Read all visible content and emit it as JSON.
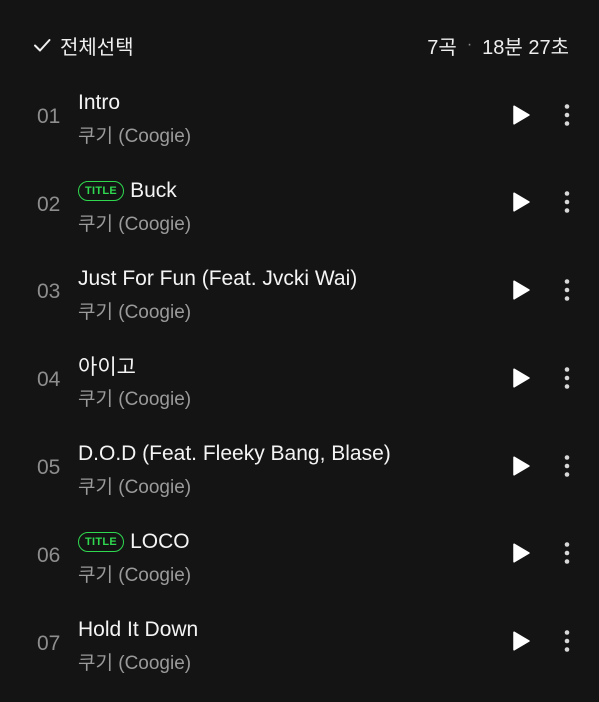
{
  "header": {
    "select_all_label": "전체선택",
    "track_count": "7곡",
    "separator": "·",
    "total_duration": "18분 27초"
  },
  "colors": {
    "background": "#141414",
    "accent_badge": "#2fd84f",
    "primary_text": "#f4f4f4",
    "secondary_text": "#9a9a9a"
  },
  "tracks": [
    {
      "no": "01",
      "title": "Intro",
      "artist": "쿠기 (Coogie)",
      "badge": ""
    },
    {
      "no": "02",
      "title": "Buck",
      "artist": "쿠기 (Coogie)",
      "badge": "TITLE"
    },
    {
      "no": "03",
      "title": "Just For Fun (Feat. Jvcki Wai)",
      "artist": "쿠기 (Coogie)",
      "badge": ""
    },
    {
      "no": "04",
      "title": "아이고",
      "artist": "쿠기 (Coogie)",
      "badge": ""
    },
    {
      "no": "05",
      "title": "D.O.D (Feat. Fleeky Bang, Blase)",
      "artist": "쿠기 (Coogie)",
      "badge": ""
    },
    {
      "no": "06",
      "title": "LOCO",
      "artist": "쿠기 (Coogie)",
      "badge": "TITLE"
    },
    {
      "no": "07",
      "title": "Hold It Down",
      "artist": "쿠기 (Coogie)",
      "badge": ""
    }
  ],
  "icons": {
    "select": "check-icon",
    "play": "play-icon",
    "more": "more-vertical-icon"
  }
}
